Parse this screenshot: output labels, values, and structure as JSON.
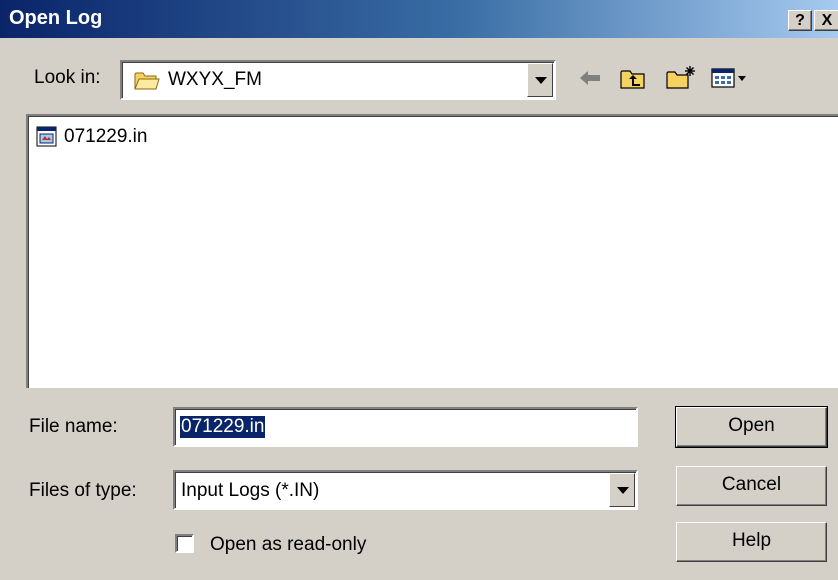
{
  "window": {
    "title": "Open Log",
    "help_label": "?",
    "close_label": "X"
  },
  "lookin": {
    "label": "Look in:",
    "value": "WXYX_FM"
  },
  "files": [
    {
      "name": "071229.in"
    }
  ],
  "filename": {
    "label": "File name:",
    "value": "071229.in"
  },
  "filetype": {
    "label": "Files of type:",
    "value": "Input Logs (*.IN)"
  },
  "readonly": {
    "label": "Open as read-only",
    "checked": false
  },
  "buttons": {
    "open": "Open",
    "cancel": "Cancel",
    "help": "Help"
  },
  "colors": {
    "titlebar_start": "#0a246a",
    "titlebar_end": "#a6caf0",
    "dialog_face": "#d4d0c8",
    "selection": "#0a246a"
  }
}
